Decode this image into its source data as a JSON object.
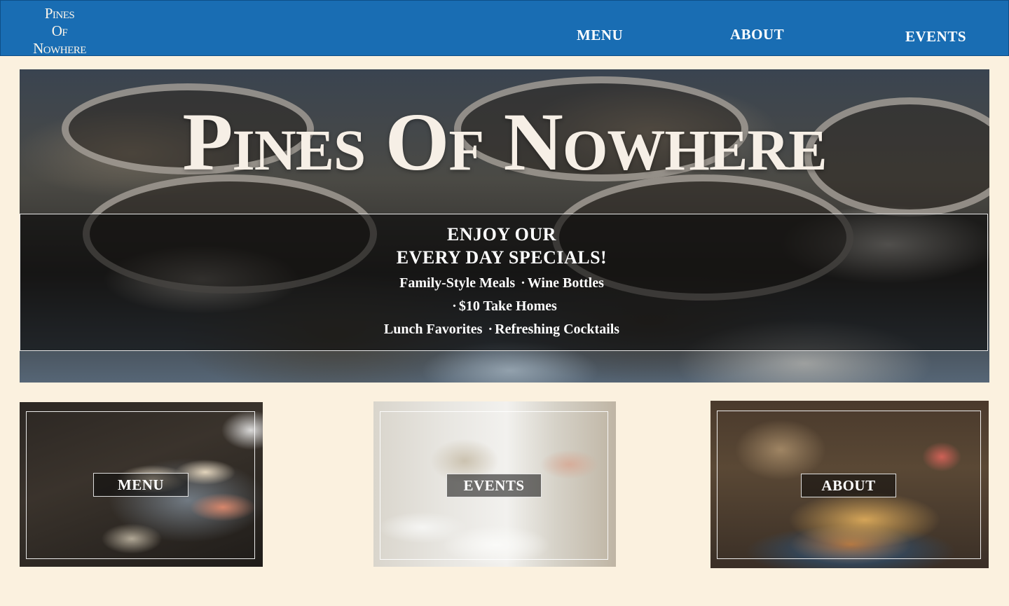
{
  "navbar": {
    "logo_line1": "Pines",
    "logo_line2": "Of",
    "logo_line3": "Nowhere",
    "links": [
      {
        "label": "MENU"
      },
      {
        "label": "ABOUT"
      },
      {
        "label": "EVENTS"
      }
    ],
    "background_color": "#196db3"
  },
  "hero": {
    "title": "Pines Of Nowhere",
    "specials": {
      "heading_line1": "ENJOY OUR",
      "heading_line2": "EVERY DAY SPECIALS!",
      "items": [
        "Family-Style Meals",
        "Wine Bottles",
        "$10 Take Homes",
        "Lunch Favorites",
        "Refreshing Cocktails"
      ],
      "separator": "·"
    }
  },
  "cards": [
    {
      "label": "MENU"
    },
    {
      "label": "EVENTS"
    },
    {
      "label": "ABOUT"
    }
  ],
  "colors": {
    "page_background": "#fbf1df",
    "nav_background": "#196db3",
    "nav_text": "#ffffff"
  }
}
